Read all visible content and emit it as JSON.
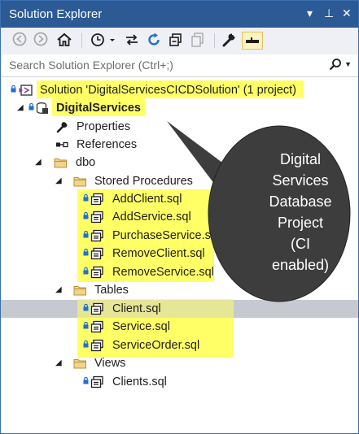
{
  "window": {
    "title": "Solution Explorer",
    "controls": {
      "dropdown": "▾",
      "pin": "⊥",
      "close": "✕"
    }
  },
  "toolbar": {
    "buttons": [
      {
        "icon": "back-icon",
        "glyph": "◀",
        "enabled": false
      },
      {
        "icon": "forward-icon",
        "glyph": "▶",
        "enabled": false
      },
      {
        "icon": "home-icon",
        "glyph": "⌂",
        "enabled": true
      },
      {
        "icon": "history-icon",
        "glyph": "◷",
        "enabled": true
      },
      {
        "icon": "sync-icon",
        "glyph": "⇆",
        "enabled": true
      },
      {
        "icon": "refresh-icon",
        "glyph": "↻",
        "enabled": true
      },
      {
        "icon": "collapse-all-icon",
        "glyph": "❐",
        "enabled": true
      },
      {
        "icon": "show-all-files-icon",
        "glyph": "⧉",
        "enabled": false
      },
      {
        "icon": "properties-wrench-icon",
        "glyph": "🔧",
        "enabled": true
      },
      {
        "icon": "preview-icon",
        "glyph": "▬",
        "enabled": true
      }
    ]
  },
  "search": {
    "placeholder": "Search Solution Explorer (Ctrl+;)",
    "value": ""
  },
  "tree": {
    "solution": "Solution 'DigitalServicesCICDSolution' (1 project)",
    "project": "DigitalServices",
    "properties": "Properties",
    "references": "References",
    "dbo": "dbo",
    "stored_procedures": {
      "label": "Stored Procedures",
      "items": [
        "AddClient.sql",
        "AddService.sql",
        "PurchaseService.sql",
        "RemoveClient.sql",
        "RemoveService.sql"
      ]
    },
    "tables": {
      "label": "Tables",
      "items": [
        "Client.sql",
        "Service.sql",
        "ServiceOrder.sql"
      ]
    },
    "views": {
      "label": "Views",
      "items": [
        "Clients.sql"
      ]
    }
  },
  "callout": {
    "lines": [
      "Digital",
      "Services",
      "Database",
      "Project",
      "(CI",
      "enabled)"
    ]
  },
  "colors": {
    "titlebar": "#2c5a95",
    "highlight": "#ffff66",
    "selected_row": "#c6c9d0",
    "callout": "#3d3d3d",
    "lock": "#1e6fd0"
  }
}
